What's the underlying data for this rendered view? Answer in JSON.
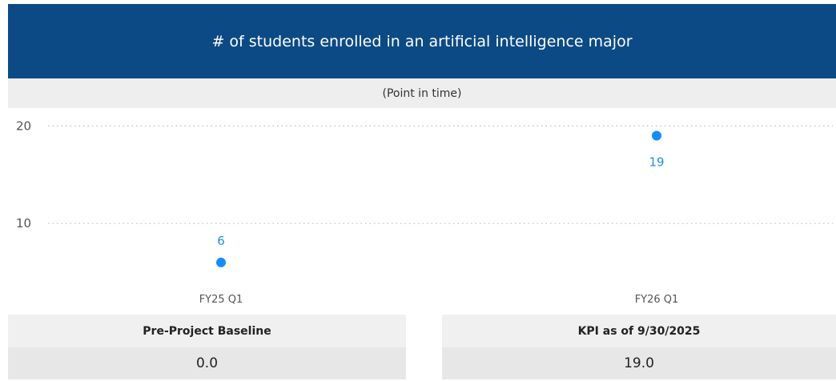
{
  "header": {
    "title": "# of students enrolled in an artificial intelligence major",
    "subtitle": "(Point in time)"
  },
  "colors": {
    "header_bg": "#0b4a85",
    "point": "#118dff",
    "label": "#1f8eea"
  },
  "chart_data": {
    "type": "scatter",
    "categories": [
      "FY25 Q1",
      "FY26 Q1"
    ],
    "values": [
      6,
      19
    ],
    "data_labels": [
      "6",
      "19"
    ],
    "yticks": [
      "10",
      "20"
    ],
    "title": "",
    "xlabel": "",
    "ylabel": "",
    "ylim": [
      4.6,
      21.5
    ],
    "grid": true,
    "gridline_values": [
      10,
      20
    ]
  },
  "kpis": {
    "baseline": {
      "label": "Pre-Project Baseline",
      "value": "0.0"
    },
    "current": {
      "label": "KPI as of 9/30/2025",
      "value": "19.0"
    }
  }
}
